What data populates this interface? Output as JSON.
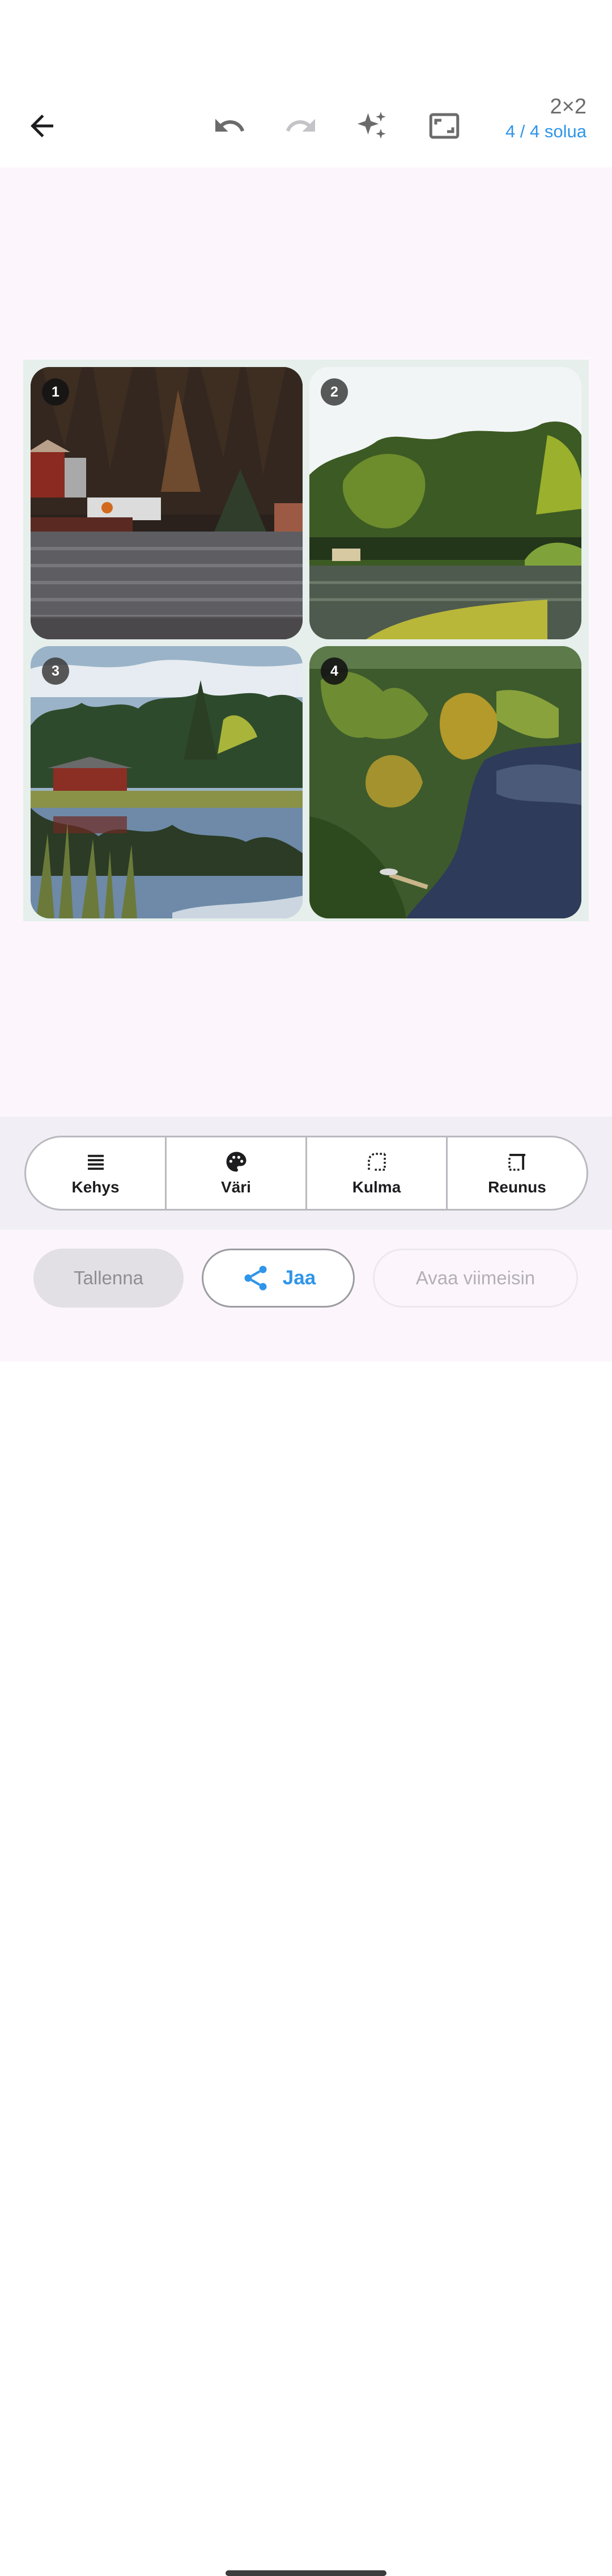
{
  "toolbar": {
    "back_icon": "arrow-left-icon",
    "undo_icon": "undo-icon",
    "redo_icon": "redo-icon",
    "auto_icon": "sparkle-icon",
    "aspect_icon": "aspect-ratio-icon",
    "grid_size": "2×2",
    "cells_count": "4 / 4 solua"
  },
  "collage": {
    "cells": [
      {
        "badge": "1",
        "photo": "lake-shore-boathouse-forest"
      },
      {
        "badge": "2",
        "photo": "lake-with-green-trees"
      },
      {
        "badge": "3",
        "photo": "red-barn-lake-reflection"
      },
      {
        "badge": "4",
        "photo": "aerial-forest-lake-pier"
      }
    ],
    "frame_color": "#e6efeb"
  },
  "tools": [
    {
      "label": "Kehys",
      "icon": "frame-lines-icon"
    },
    {
      "label": "Väri",
      "icon": "palette-icon"
    },
    {
      "label": "Kulma",
      "icon": "rounded-corner-icon"
    },
    {
      "label": "Reunus",
      "icon": "border-icon"
    }
  ],
  "actions": {
    "save": "Tallenna",
    "share": "Jaa",
    "share_icon": "share-icon",
    "open_recent": "Avaa viimeisin"
  },
  "colors": {
    "accent": "#2f95e8",
    "canvas_bg": "#fcf6fc"
  }
}
